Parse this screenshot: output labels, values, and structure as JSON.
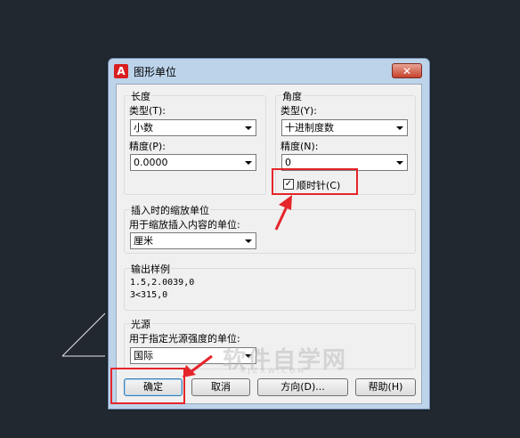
{
  "dialog": {
    "title": "图形单位",
    "close_label": "✕",
    "app_icon_label": "A"
  },
  "length": {
    "group_title": "长度",
    "type_label": "类型(T):",
    "type_value": "小数",
    "precision_label": "精度(P):",
    "precision_value": "0.0000"
  },
  "angle": {
    "group_title": "角度",
    "type_label": "类型(Y):",
    "type_value": "十进制度数",
    "precision_label": "精度(N):",
    "precision_value": "0",
    "clockwise_label": "顺时针(C)",
    "clockwise_checked": true
  },
  "insertion": {
    "group_title": "插入时的缩放单位",
    "label": "用于缩放插入内容的单位:",
    "value": "厘米"
  },
  "sample": {
    "group_title": "输出样例",
    "line1": "1.5,2.0039,0",
    "line2": "3<315,0"
  },
  "lighting": {
    "group_title": "光源",
    "label": "用于指定光源强度的单位:",
    "value": "国际"
  },
  "buttons": {
    "ok": "确定",
    "cancel": "取消",
    "direction": "方向(D)...",
    "help": "帮助(H)"
  },
  "watermark": {
    "main": "软件自学网",
    "sub": "RJZXW.COM"
  },
  "colors": {
    "highlight": "#e5252a",
    "background": "#212830"
  }
}
